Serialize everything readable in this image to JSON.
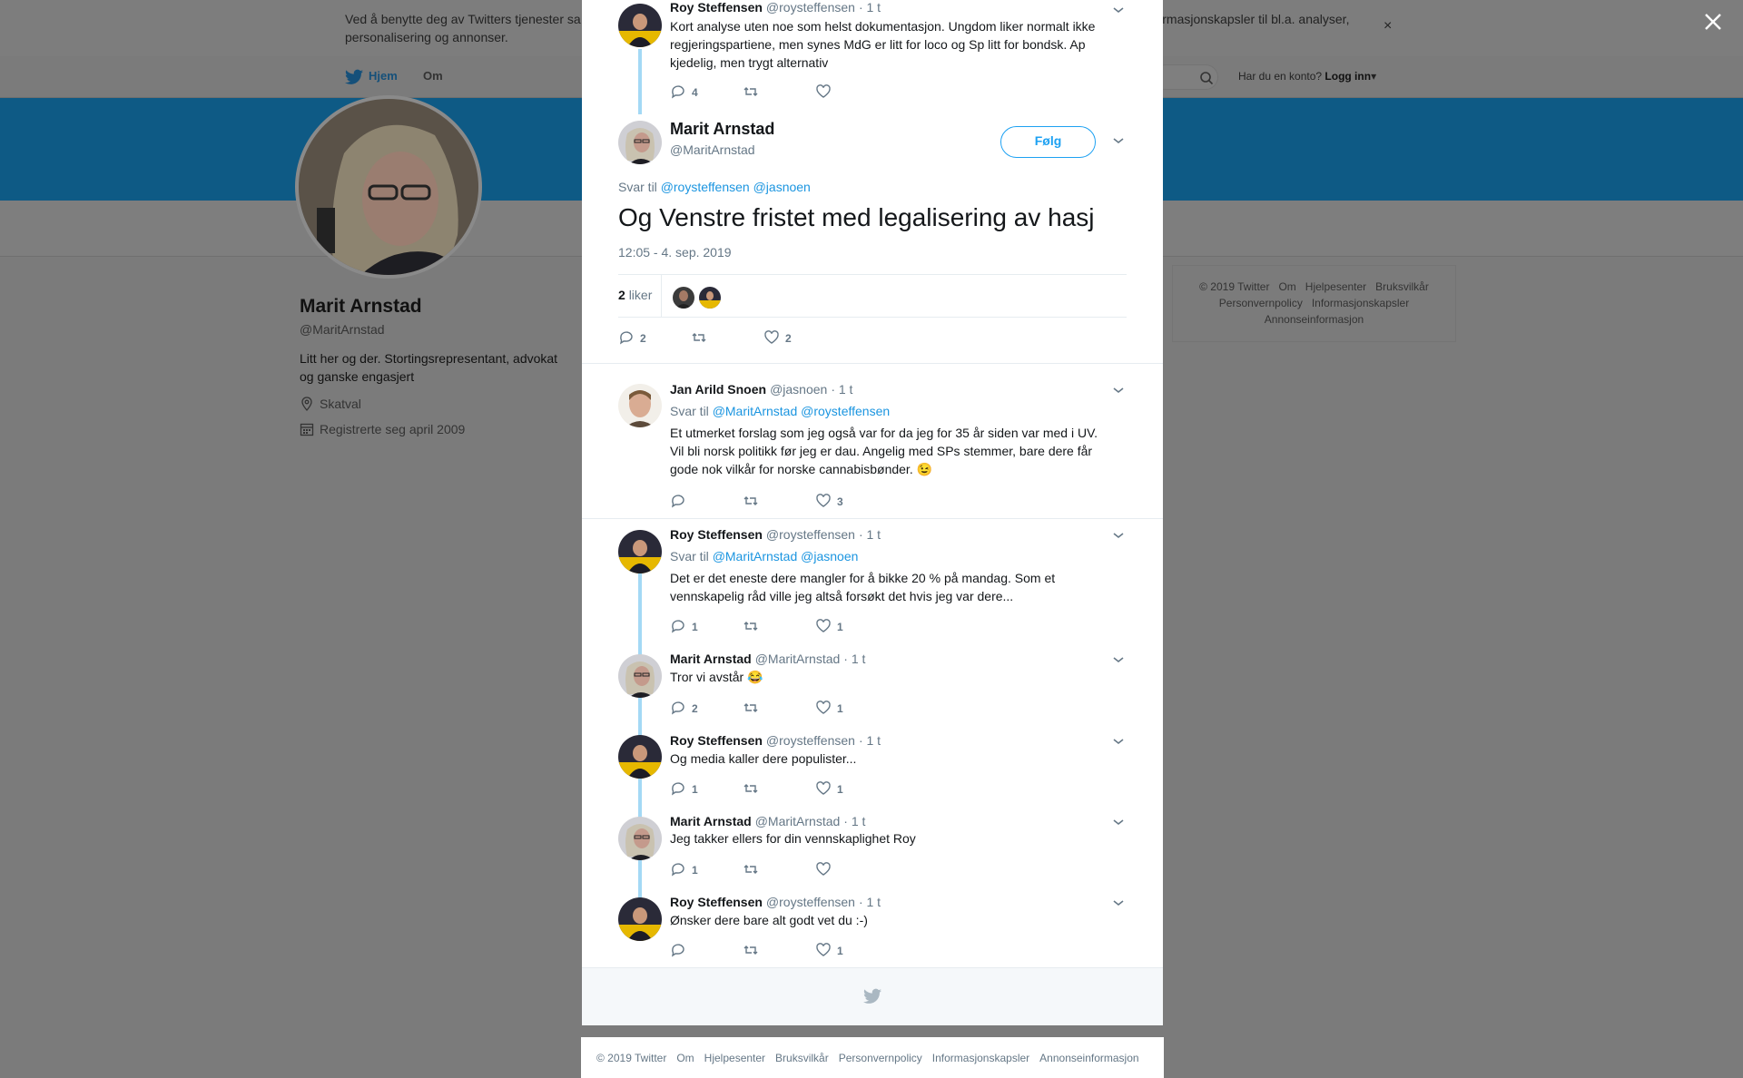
{
  "cookie_banner": {
    "text_left": "Ved å benytte deg av Twitters tjenester sa",
    "text_right": "informasjonskapsler til bl.a. analyser,",
    "text_line2": "personalisering og annonser.",
    "close": "×"
  },
  "topnav": {
    "home": "Hjem",
    "about": "Om",
    "account_prompt": "Har du en konto?",
    "login": "Logg inn"
  },
  "profile": {
    "name": "Marit Arnstad",
    "handle": "@MaritArnstad",
    "bio": "Litt her og der. Stortingsrepresentant, advokat og ganske engasjert",
    "location": "Skatval",
    "joined": "Registrerte seg april 2009"
  },
  "side_footer": [
    "© 2019 Twitter",
    "Om",
    "Hjelpesenter",
    "Bruksvilkår",
    "Personvernpolicy",
    "Informasjonskapsler",
    "Annonseinformasjon"
  ],
  "modal_footer": [
    "© 2019 Twitter",
    "Om",
    "Hjelpesenter",
    "Bruksvilkår",
    "Personvernpolicy",
    "Informasjonskapsler",
    "Annonseinformasjon"
  ],
  "parent_tweet": {
    "name": "Roy Steffensen",
    "handle": "@roysteffensen",
    "time": "· 1 t",
    "text": "Kort analyse uten noe som helst dokumentasjon. Ungdom liker normalt ikke regjeringspartiene, men synes MdG er litt for loco og Sp litt for bondsk. Ap kjedelig, men trygt alternativ",
    "replies": "4",
    "retweets": "",
    "likes": ""
  },
  "focus_tweet": {
    "name": "Marit Arnstad",
    "handle": "@MaritArnstad",
    "follow": "Følg",
    "reply_prefix": "Svar til",
    "reply_to_1": "@roysteffensen",
    "reply_to_2": "@jasnoen",
    "text": "Og Venstre fristet med legalisering av hasj",
    "date": "12:05 - 4. sep. 2019",
    "likes_num": "2",
    "likes_word": "liker",
    "replies": "2",
    "retweets": "",
    "likes": "2"
  },
  "replies": [
    {
      "name": "Jan Arild Snoen",
      "handle": "@jasnoen",
      "time": "· 1 t",
      "reply_prefix": "Svar til",
      "reply_to": "@MaritArnstad @roysteffensen",
      "text": "Et utmerket forslag som jeg også var for da jeg for 35 år siden var med i UV. Vil bli norsk politikk før jeg er dau. Angelig med SPs stemmer, bare dere får gode nok vilkår for norske cannabisbønder. 😉",
      "replies": "",
      "retweets": "",
      "likes": "3"
    },
    {
      "name": "Roy Steffensen",
      "handle": "@roysteffensen",
      "time": "· 1 t",
      "reply_prefix": "Svar til",
      "reply_to": "@MaritArnstad @jasnoen",
      "text": "Det er det eneste dere mangler for å bikke 20 % på mandag. Som et vennskapelig råd ville jeg altså forsøkt det hvis jeg var dere...",
      "replies": "1",
      "retweets": "",
      "likes": "1"
    },
    {
      "name": "Marit Arnstad",
      "handle": "@MaritArnstad",
      "time": "· 1 t",
      "text": "Tror vi avstår 😂",
      "replies": "2",
      "retweets": "",
      "likes": "1"
    },
    {
      "name": "Roy Steffensen",
      "handle": "@roysteffensen",
      "time": "· 1 t",
      "text": "Og media kaller dere populister...",
      "replies": "1",
      "retweets": "",
      "likes": "1"
    },
    {
      "name": "Marit Arnstad",
      "handle": "@MaritArnstad",
      "time": "· 1 t",
      "text": "Jeg takker ellers for din vennskaplighet Roy",
      "replies": "1",
      "retweets": "",
      "likes": ""
    },
    {
      "name": "Roy Steffensen",
      "handle": "@roysteffensen",
      "time": "· 1 t",
      "text": "Ønsker dere bare alt godt vet du :-)",
      "replies": "",
      "retweets": "",
      "likes": "1"
    }
  ],
  "colors": {
    "link": "#1b95e0",
    "thread_line": "#a4d9f5",
    "brand": "#1da1f2"
  }
}
